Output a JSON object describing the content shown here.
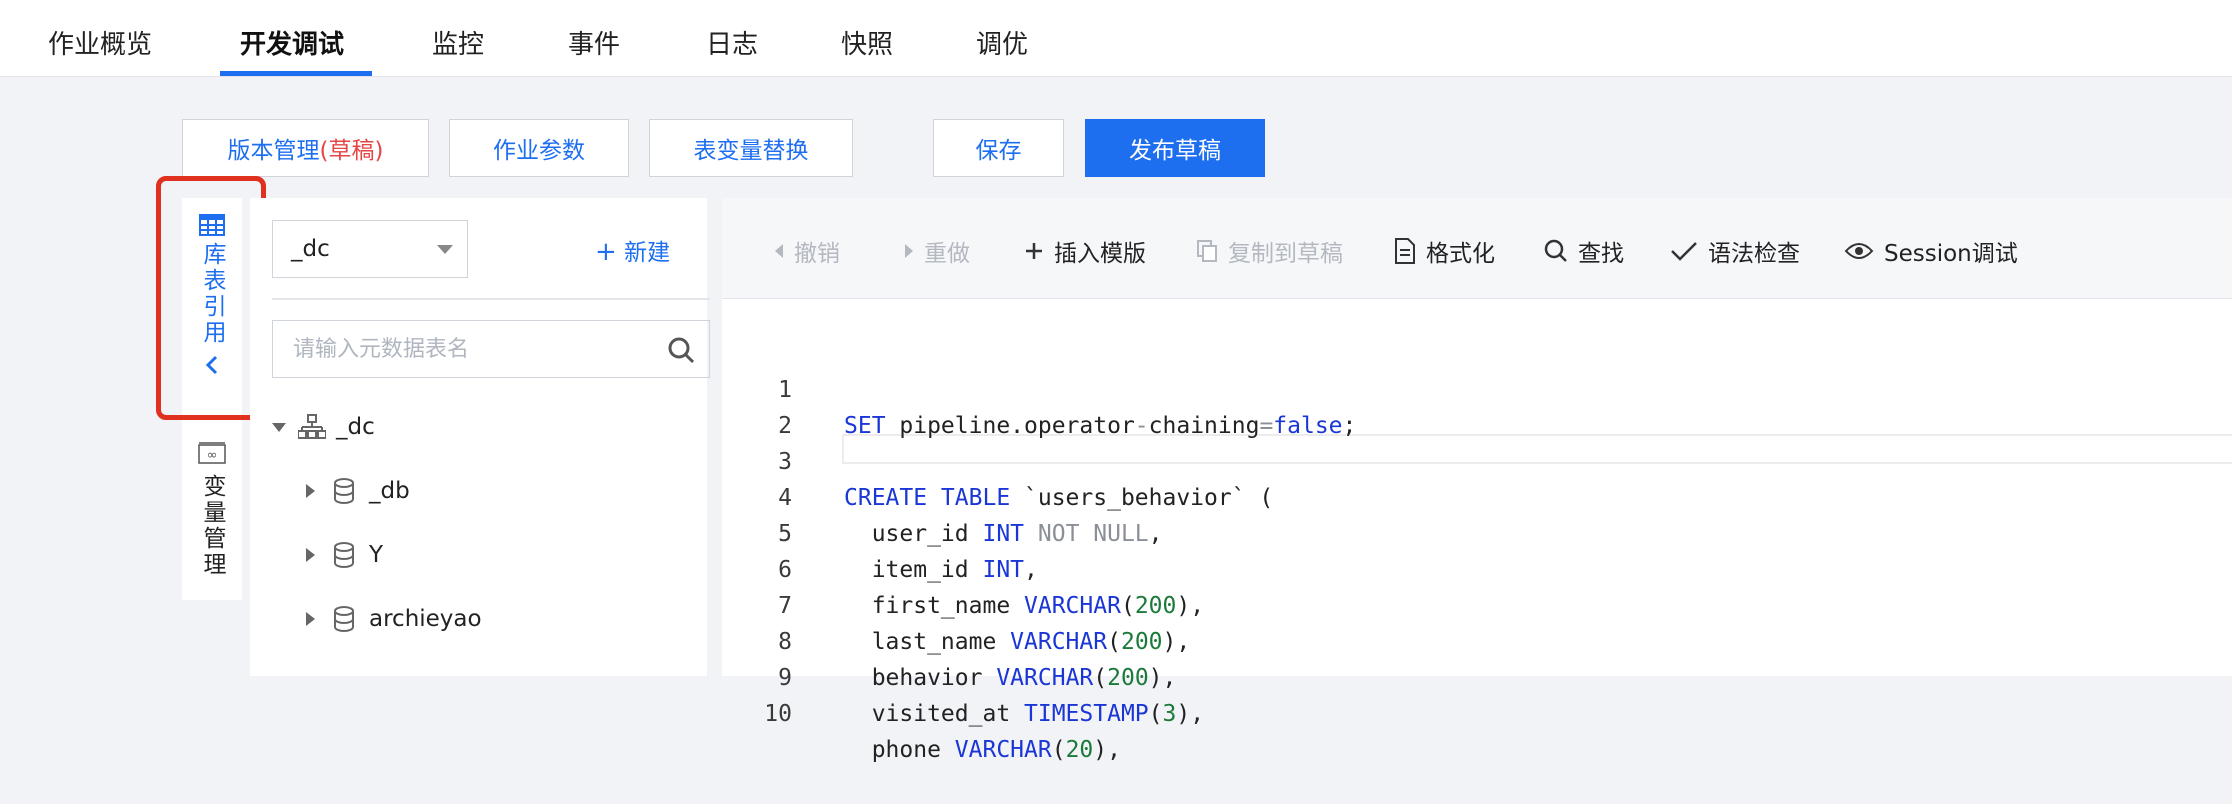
{
  "tabs": [
    {
      "label": "作业概览"
    },
    {
      "label": "开发调试"
    },
    {
      "label": "监控"
    },
    {
      "label": "事件"
    },
    {
      "label": "日志"
    },
    {
      "label": "快照"
    },
    {
      "label": "调优"
    }
  ],
  "active_tab": "开发调试",
  "actions": {
    "version_label": "版本管理",
    "version_draft": "(草稿)",
    "job_params": "作业参数",
    "table_var_replace": "表变量替换",
    "save": "保存",
    "publish_draft": "发布草稿"
  },
  "rail": {
    "table_ref": "库表引用",
    "var_manage": "变量管理"
  },
  "panel": {
    "db_selected": "_dc",
    "new_label": "新建",
    "search_placeholder": "请输入元数据表名",
    "tree": {
      "root": "_dc",
      "children": [
        "_db",
        "Y",
        "archieyao"
      ]
    }
  },
  "toolbar": {
    "undo": "撤销",
    "redo": "重做",
    "insert_template": "插入模版",
    "copy_to_draft": "复制到草稿",
    "format": "格式化",
    "find": "查找",
    "syntax_check": "语法检查",
    "session_debug": "Session调试"
  },
  "code": {
    "line_numbers": [
      "1",
      "2",
      "3",
      "4",
      "5",
      "6",
      "7",
      "8",
      "9",
      "10"
    ],
    "l1_kw": "SET",
    "l1_a": " pipeline.operator",
    "l1_op": "-",
    "l1_b": "chaining",
    "l1_eq": "=",
    "l1_val": "false",
    "l1_end": ";",
    "l3_kw": "CREATE TABLE",
    "l3_rest": " `users_behavior` (",
    "l4_name": "  user_id ",
    "l4_type": "INT",
    "l4_cons": " NOT NULL",
    "l4_end": ",",
    "l5_name": "  item_id ",
    "l5_type": "INT",
    "l5_end": ",",
    "l6_name": "  first_name ",
    "l6_type": "VARCHAR",
    "l6_open": "(",
    "l6_num": "200",
    "l6_end": "),",
    "l7_name": "  last_name ",
    "l7_type": "VARCHAR",
    "l7_open": "(",
    "l7_num": "200",
    "l7_end": "),",
    "l8_name": "  behavior ",
    "l8_type": "VARCHAR",
    "l8_open": "(",
    "l8_num": "200",
    "l8_end": "),",
    "l9_name": "  visited_at ",
    "l9_type": "TIMESTAMP",
    "l9_open": "(",
    "l9_num": "3",
    "l9_end": "),",
    "l10_name": "  phone ",
    "l10_type": "VARCHAR",
    "l10_open": "(",
    "l10_num": "20",
    "l10_end": "),"
  },
  "colors": {
    "accent": "#1e6ff0",
    "highlight_border": "#e0301e",
    "draft_tag": "#e54545",
    "keyword": "#1a36d6",
    "number": "#1b7a3a"
  }
}
